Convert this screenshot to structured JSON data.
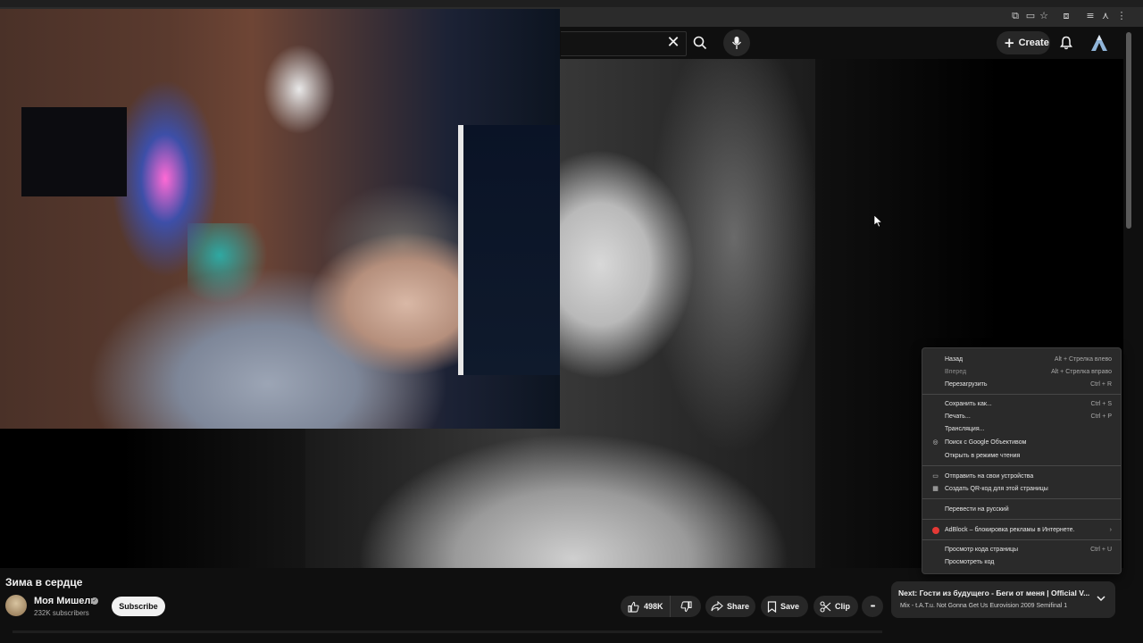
{
  "header": {
    "search_clear": "✕",
    "create_label": "Create"
  },
  "video": {
    "title": "Зима в сердце"
  },
  "channel": {
    "name": "Моя Мишель",
    "subscribers": "232K subscribers",
    "subscribe_label": "Subscribe"
  },
  "actions": {
    "likes": "498K",
    "share_label": "Share",
    "save_label": "Save",
    "clip_label": "Clip",
    "more_label": "•••"
  },
  "next_up": {
    "prefix": "Next:",
    "title": "Гости из будущего - Беги от меня | Official V...",
    "subtitle": "Mix - t.A.T.u. Not Gonna Get Us Eurovision 2009 Semifinal 1"
  },
  "context_menu": {
    "items": [
      {
        "label": "Назад",
        "shortcut": "Alt + Стрелка влево"
      },
      {
        "label": "Вперед",
        "shortcut": "Alt + Стрелка вправо"
      },
      {
        "label": "Перезагрузить",
        "shortcut": "Ctrl + R"
      },
      {
        "label": "Сохранить как...",
        "shortcut": "Ctrl + S"
      },
      {
        "label": "Печать...",
        "shortcut": "Ctrl + P"
      },
      {
        "label": "Трансляция...",
        "shortcut": ""
      },
      {
        "label": "Поиск с Google Объективом",
        "shortcut": ""
      },
      {
        "label": "Открыть в режиме чтения",
        "shortcut": ""
      },
      {
        "label": "Отправить на свои устройства",
        "shortcut": ""
      },
      {
        "label": "Создать QR-код для этой страницы",
        "shortcut": ""
      },
      {
        "label": "Перевести на русский",
        "shortcut": ""
      },
      {
        "label": "AdBlock – блокировка рекламы в Интернете.",
        "shortcut": "›"
      },
      {
        "label": "Просмотр кода страницы",
        "shortcut": "Ctrl + U"
      },
      {
        "label": "Просмотреть код",
        "shortcut": ""
      }
    ]
  },
  "colors": {
    "background": "#0f0f0f",
    "pill": "#272727",
    "subscribe_bg": "#f1f1f1",
    "menu_bg": "#2a2a2a"
  }
}
